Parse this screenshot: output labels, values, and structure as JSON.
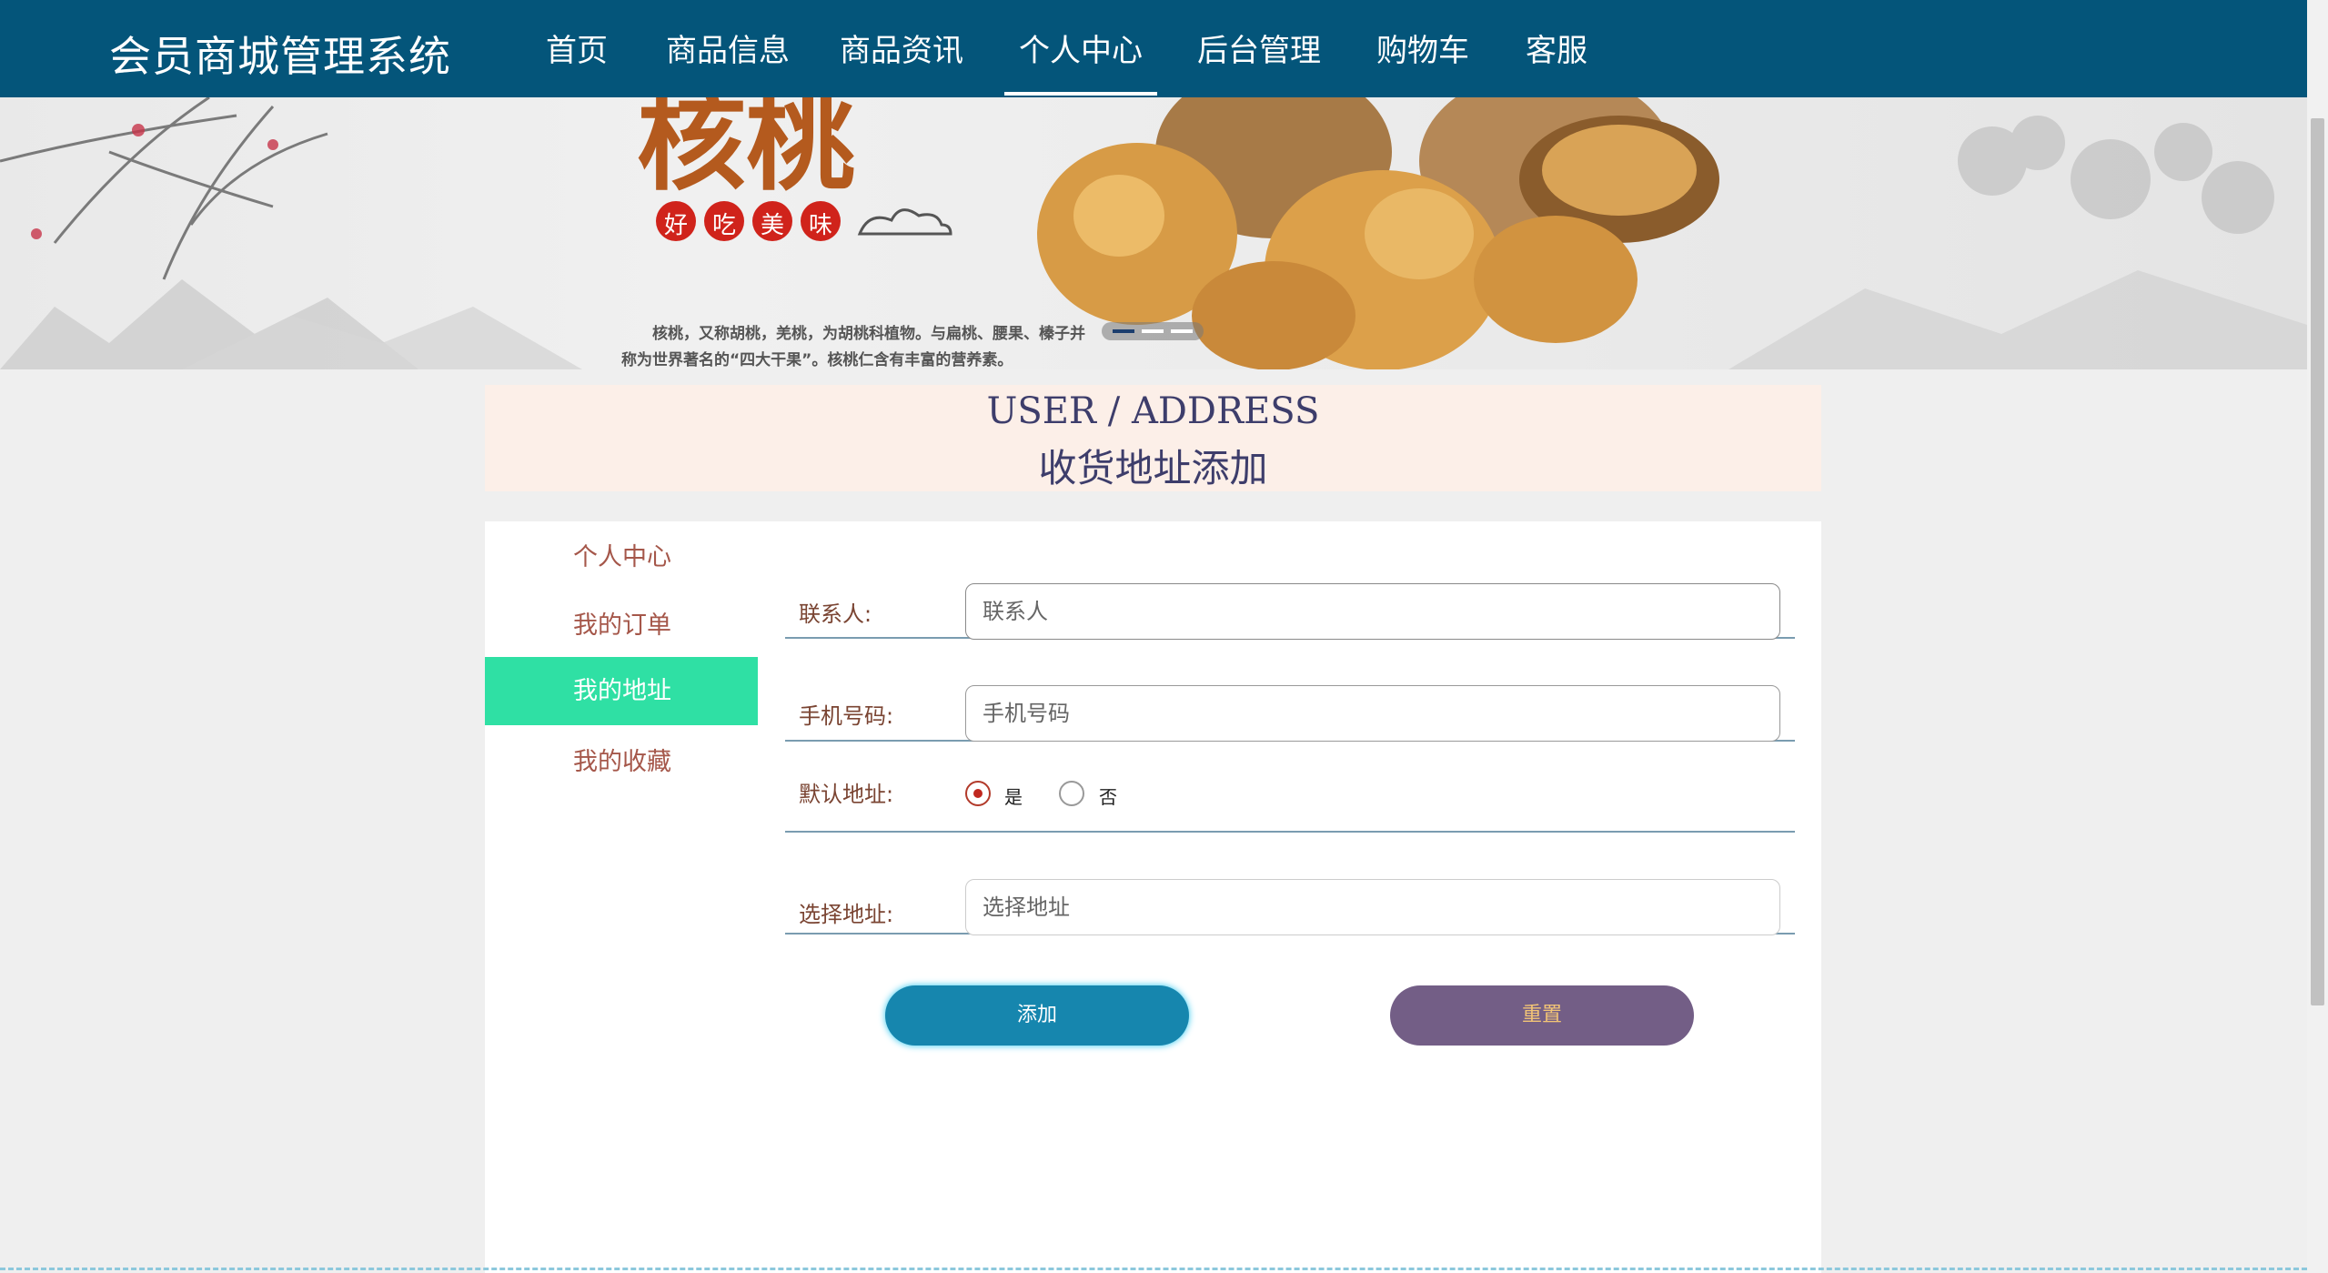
{
  "header": {
    "brand": "会员商城管理系统",
    "nav": [
      {
        "label": "首页"
      },
      {
        "label": "商品信息"
      },
      {
        "label": "商品资讯"
      },
      {
        "label": "个人中心",
        "active": true
      },
      {
        "label": "后台管理"
      },
      {
        "label": "购物车"
      },
      {
        "label": "客服"
      }
    ]
  },
  "banner": {
    "slogan_chars": [
      "好",
      "吃",
      "美",
      "味"
    ],
    "desc_line1": "核桃，又称胡桃，羌桃，为胡桃科植物。与扁桃、腰果、榛子并",
    "desc_line2": "称为世界著名的“四大干果”。核桃仁含有丰富的营养素。",
    "carousel_active_index": 0
  },
  "page_title": {
    "en": "USER / ADDRESS",
    "cn": "收货地址添加"
  },
  "sidebar": {
    "items": [
      {
        "label": "个人中心"
      },
      {
        "label": "我的订单"
      },
      {
        "label": "我的地址",
        "active": true
      },
      {
        "label": "我的收藏"
      }
    ]
  },
  "form": {
    "contact": {
      "label": "联系人:",
      "placeholder": "联系人",
      "value": ""
    },
    "phone": {
      "label": "手机号码:",
      "placeholder": "手机号码",
      "value": ""
    },
    "default_address": {
      "label": "默认地址:",
      "option_yes": "是",
      "option_no": "否",
      "selected": "是"
    },
    "address": {
      "label": "选择地址:",
      "placeholder": "选择地址",
      "value": ""
    }
  },
  "buttons": {
    "add": "添加",
    "reset": "重置"
  },
  "colors": {
    "nav_bg": "#04557a",
    "sidebar_active": "#2fe0a4",
    "add_button": "#1686ae",
    "reset_button": "#735e86",
    "title_bg": "#fcefe8"
  }
}
